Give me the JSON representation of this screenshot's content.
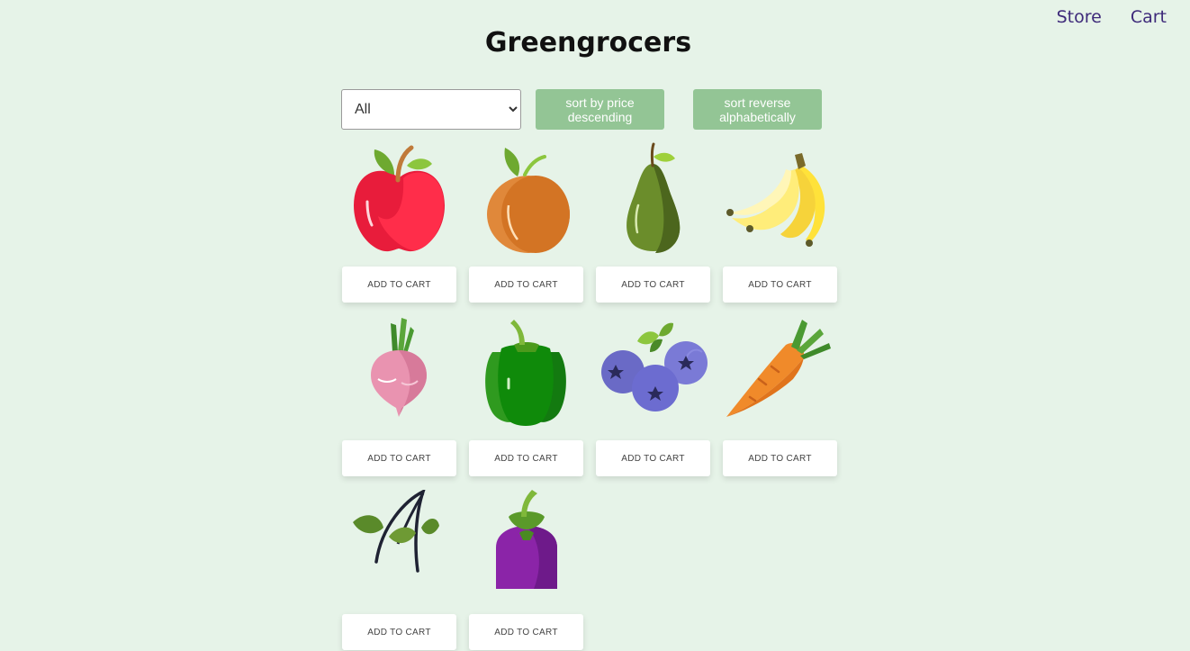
{
  "nav": {
    "store": "Store",
    "cart": "Cart"
  },
  "header": {
    "title": "Greengrocers"
  },
  "filters": {
    "category_selected": "All",
    "sort_price_label": "sort by price descending",
    "sort_alpha_label": "sort reverse alphabetically"
  },
  "products": [
    {
      "icon": "apple-icon",
      "button": "ADD TO CART"
    },
    {
      "icon": "apricot-icon",
      "button": "ADD TO CART"
    },
    {
      "icon": "avocado-icon",
      "button": "ADD TO CART"
    },
    {
      "icon": "banana-icon",
      "button": "ADD TO CART"
    },
    {
      "icon": "radish-icon",
      "button": "ADD TO CART"
    },
    {
      "icon": "green-pepper-icon",
      "button": "ADD TO CART"
    },
    {
      "icon": "blueberry-icon",
      "button": "ADD TO CART"
    },
    {
      "icon": "carrot-icon",
      "button": "ADD TO CART"
    },
    {
      "icon": "leaves-icon",
      "button": "ADD TO CART"
    },
    {
      "icon": "eggplant-icon",
      "button": "ADD TO CART"
    }
  ]
}
